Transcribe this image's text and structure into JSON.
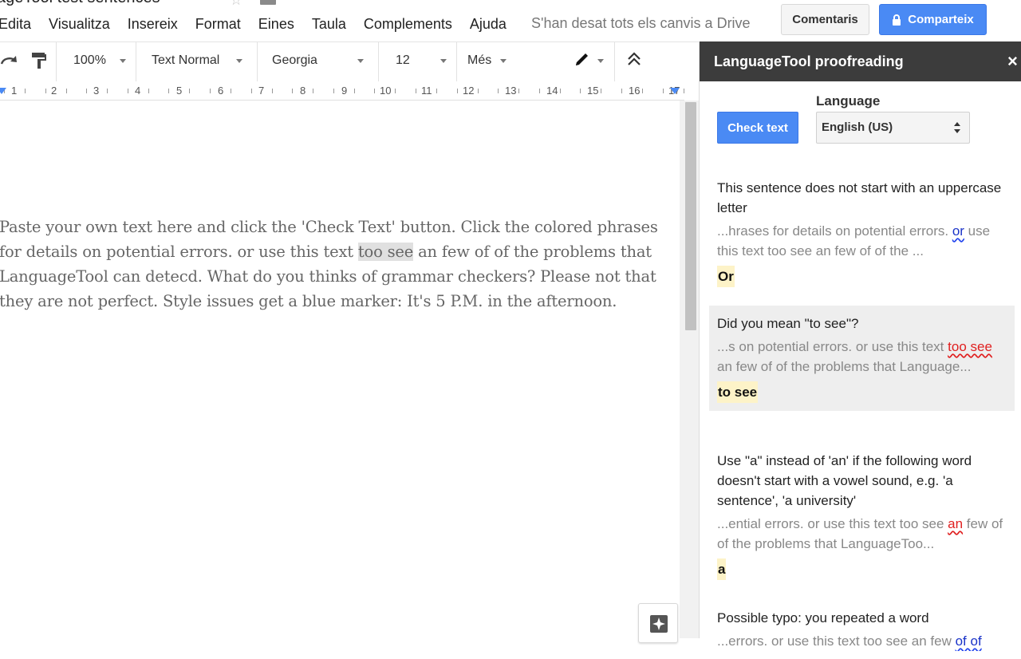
{
  "app": {
    "doc_title": "ageTool test sentences",
    "save_status": "S'han desat tots els canvis a Drive",
    "comments_label": "Comentaris",
    "share_label": "Comparteix"
  },
  "menu": [
    "Edita",
    "Visualitza",
    "Insereix",
    "Format",
    "Eines",
    "Taula",
    "Complements",
    "Ajuda"
  ],
  "toolbar": {
    "zoom": "100%",
    "style": "Text Normal",
    "font": "Georgia",
    "size": "12",
    "more": "Més"
  },
  "ruler": [
    "1",
    "2",
    "3",
    "4",
    "5",
    "6",
    "7",
    "8",
    "9",
    "10",
    "11",
    "12",
    "13",
    "14",
    "15",
    "16",
    "17"
  ],
  "document": {
    "before": "Paste your own text here and click the 'Check Text' button. Click the colored phrases for details on potential errors. or use this text ",
    "highlight": "too see",
    "after": " an few of of the problems that LanguageTool can detecd. What do you thinks of grammar checkers? Please not that they are not perfect. Style issues get a blue marker: It's 5 P.M. in the afternoon."
  },
  "sidebar": {
    "title": "LanguageTool proofreading",
    "close_icon": "×",
    "check_button": "Check text",
    "language_label": "Language",
    "language_value": "English (US)",
    "issues": [
      {
        "title": "This sentence does not start with an uppercase letter",
        "context_before": "...hrases for details on potential errors. ",
        "context_error": "or",
        "context_after": " use this text too see an few of of the ...",
        "error_style": "blue",
        "suggestion": "Or"
      },
      {
        "title": "Did you mean \"to see\"?",
        "context_before": "...s on potential errors. or use this text ",
        "context_error": "too see",
        "context_after": " an few of of the problems that Language...",
        "error_style": "red",
        "suggestion": "to see"
      },
      {
        "title": "Use \"a\" instead of 'an' if the following word doesn't start with a vowel sound, e.g. 'a sentence', 'a university'",
        "context_before": "...ential errors. or use this text too see ",
        "context_error": "an",
        "context_after": " few of of the problems that LanguageToo...",
        "error_style": "red",
        "suggestion": "a"
      },
      {
        "title": "Possible typo: you repeated a word",
        "context_before": "...errors. or use this text too see an few ",
        "context_error": "of of",
        "context_after": "",
        "error_style": "blue",
        "suggestion": ""
      }
    ]
  },
  "colors": {
    "accent": "#4a8af4",
    "sidebar_header": "#3c3c3c",
    "error_red": "#e02020",
    "error_blue": "#1a33c8",
    "suggestion_bg": "#fdf3c8"
  }
}
